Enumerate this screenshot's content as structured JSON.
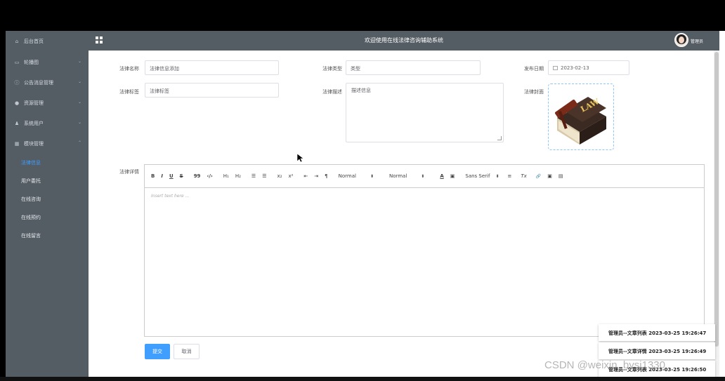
{
  "header": {
    "title": "欢迎使用在线法律咨询辅助系统",
    "user": "管理员"
  },
  "sidebar": {
    "items": [
      {
        "icon": "home-icon",
        "label": "后台首页"
      },
      {
        "icon": "image-icon",
        "label": "轮播图"
      },
      {
        "icon": "info-icon",
        "label": "公告消息管理"
      },
      {
        "icon": "location-icon",
        "label": "资源管理"
      },
      {
        "icon": "user-icon",
        "label": "系统用户"
      },
      {
        "icon": "grid-icon",
        "label": "模块管理"
      }
    ],
    "subitems": [
      {
        "label": "法律信息",
        "active": true
      },
      {
        "label": "用户委托",
        "active": false
      },
      {
        "label": "在线咨询",
        "active": false
      },
      {
        "label": "在线预约",
        "active": false
      },
      {
        "label": "在线留言",
        "active": false
      }
    ]
  },
  "form": {
    "name_label": "法律名称",
    "name_value": "法律信息添加",
    "type_label": "法律类型",
    "type_value": "类型",
    "date_label": "发布日期",
    "date_value": "2023-02-13",
    "tag_label": "法律标签",
    "tag_value": "法律标签",
    "desc_label": "法律描述",
    "desc_value": "描述信息",
    "cover_label": "法律封面",
    "detail_label": "法律详情",
    "editor_placeholder": "Insert text here ...",
    "submit_label": "提交",
    "cancel_label": "取消"
  },
  "toolbar": {
    "bold": "B",
    "italic": "I",
    "underline": "U",
    "strike": "S",
    "quote": "99",
    "code": "‹/›",
    "h1": "H₁",
    "h2": "H₂",
    "ol": "☰",
    "ul": "☰",
    "sub": "x₂",
    "sup": "x²",
    "outdent": "⇤",
    "indent": "⇥",
    "direction": "¶",
    "size": "Normal",
    "header": "Normal",
    "color": "A",
    "background": "▣",
    "font": "Sans Serif",
    "align": "≡",
    "clean": "Tx",
    "link": "🔗",
    "image": "▣",
    "video": "▤"
  },
  "cover_image": {
    "book_text": "LAW"
  },
  "notifications": [
    {
      "text": "管理员--文章列表 2023-03-25 19:26:47"
    },
    {
      "text": "管理员--文章详情 2023-03-25 19:26:49"
    },
    {
      "text": "管理员--文章列表 2023-03-25 19:26:50"
    }
  ],
  "watermark": "CSDN @weixin_bysj1330",
  "colors": {
    "sidebar_bg": "#545c64",
    "accent": "#409eff"
  }
}
